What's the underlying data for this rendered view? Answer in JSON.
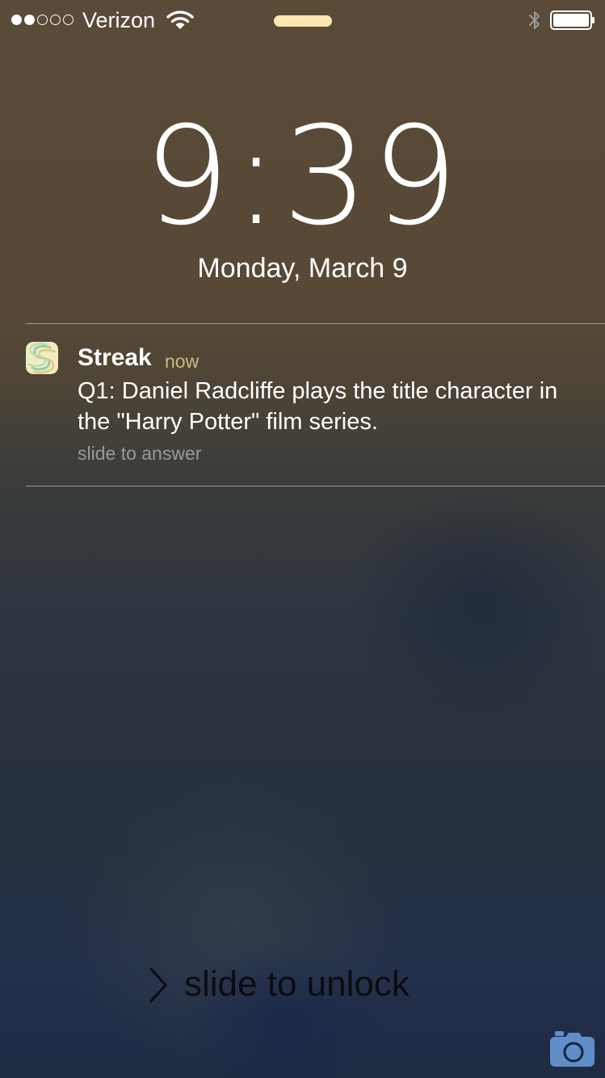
{
  "status_bar": {
    "signal_strength": 2,
    "signal_max": 5,
    "carrier": "Verizon",
    "wifi_icon": "wifi-icon",
    "bluetooth_icon": "bluetooth-icon",
    "battery_icon": "battery-icon",
    "battery_level": 1.0,
    "call_indicator_color": "#fde8b0"
  },
  "lock_screen": {
    "time": "9:39",
    "date": "Monday, March 9"
  },
  "notification": {
    "app_icon": "streak-app-icon",
    "app_name": "Streak",
    "time_ago": "now",
    "message": "Q1: Daniel Radcliffe plays the title character in the \"Harry Potter\" film series.",
    "action_hint": "slide to answer"
  },
  "unlock": {
    "chevron_icon": "chevron-right-icon",
    "label": "slide to unlock",
    "camera_icon": "camera-icon",
    "camera_color": "#5f8ec8"
  }
}
